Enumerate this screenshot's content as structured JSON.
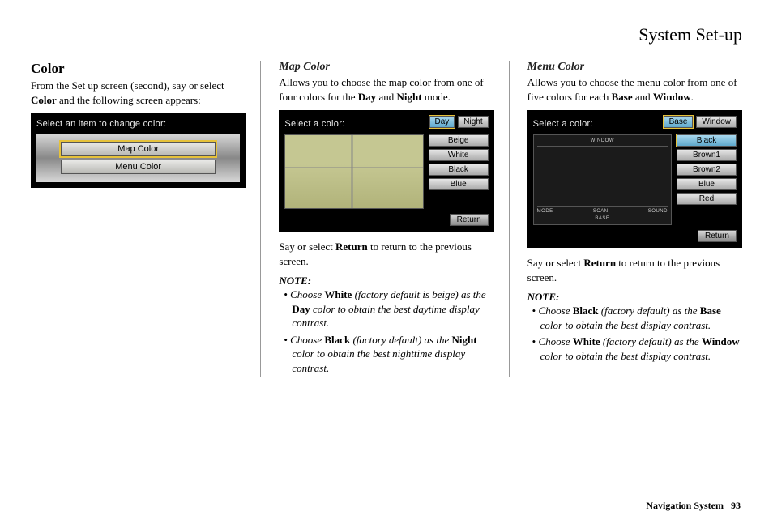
{
  "page_title": "System Set-up",
  "footer": {
    "label": "Navigation System",
    "page": "93"
  },
  "col1": {
    "heading": "Color",
    "intro_before": "From the ",
    "intro_setup": "Set up",
    "intro_mid": " screen (second), say or select ",
    "intro_color": "Color",
    "intro_after": " and the following screen appears:",
    "ss": {
      "prompt": "Select an item to change color:",
      "items": [
        "Map Color",
        "Menu Color"
      ],
      "selected": 0
    }
  },
  "col2": {
    "heading": "Map Color",
    "intro_1": "Allows you to choose the map color from one of four colors for the ",
    "intro_day": "Day",
    "intro_2": " and ",
    "intro_night": "Night",
    "intro_3": " mode.",
    "ss": {
      "prompt": "Select a color:",
      "tabs": [
        "Day",
        "Night"
      ],
      "active_tab": 0,
      "colors": [
        "Beige",
        "White",
        "Black",
        "Blue"
      ],
      "return": "Return"
    },
    "return_line_1": "Say or select ",
    "return_bold": "Return",
    "return_line_2": " to return to the previous screen.",
    "note_label": "NOTE:",
    "notes": [
      {
        "pre": "Choose ",
        "b1": "White",
        "mid1": " (factory default is beige) as the ",
        "b2": "Day",
        "post": " color to obtain the best daytime display contrast."
      },
      {
        "pre": "Choose ",
        "b1": "Black",
        "mid1": " (factory default) as the ",
        "b2": "Night",
        "post": " color to obtain the best nighttime display contrast."
      }
    ]
  },
  "col3": {
    "heading": "Menu Color",
    "intro_1": "Allows you to choose the menu color from one of five colors for each ",
    "intro_base": "Base",
    "intro_2": " and ",
    "intro_window": "Window",
    "intro_3": ".",
    "ss": {
      "prompt": "Select a color:",
      "tabs": [
        "Base",
        "Window"
      ],
      "active_tab": 0,
      "colors": [
        "Black",
        "Brown1",
        "Brown2",
        "Blue",
        "Red"
      ],
      "active_color": 0,
      "preview_labels": {
        "window": "WINDOW",
        "base": "BASE",
        "mode": "MODE",
        "scan": "SCAN",
        "sound": "SOUND"
      },
      "return": "Return"
    },
    "return_line_1": "Say or select ",
    "return_bold": "Return",
    "return_line_2": " to return to the previous screen.",
    "note_label": "NOTE:",
    "notes": [
      {
        "pre": "Choose ",
        "b1": "Black",
        "mid1": " (factory default) as the ",
        "b2": "Base",
        "post": " color to obtain the best display contrast."
      },
      {
        "pre": "Choose ",
        "b1": "White",
        "mid1": " (factory default) as the ",
        "b2": "Window",
        "post": " color to obtain the best display contrast."
      }
    ]
  }
}
